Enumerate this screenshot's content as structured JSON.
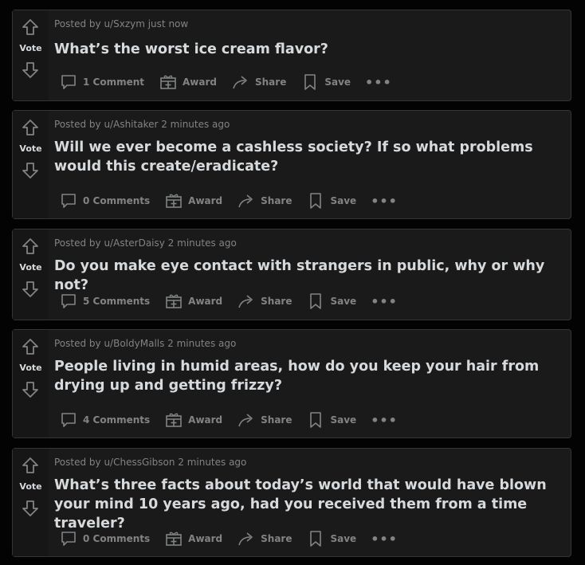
{
  "posts": [
    {
      "meta": "Posted by u/Sxzym just now",
      "title": "What’s the worst ice cream flavor?",
      "vote_label": "Vote",
      "comments": "1 Comment",
      "award": "Award",
      "share": "Share",
      "save": "Save",
      "more": "•••"
    },
    {
      "meta": "Posted by u/Ashitaker 2 minutes ago",
      "title": "Will we ever become a cashless society? If so what problems would this create/eradicate?",
      "vote_label": "Vote",
      "comments": "0 Comments",
      "award": "Award",
      "share": "Share",
      "save": "Save",
      "more": "•••"
    },
    {
      "meta": "Posted by u/AsterDaisy 2 minutes ago",
      "title": "Do you make eye contact with strangers in public, why or why not?",
      "vote_label": "Vote",
      "comments": "5 Comments",
      "award": "Award",
      "share": "Share",
      "save": "Save",
      "more": "•••"
    },
    {
      "meta": "Posted by u/BoldyMalls 2 minutes ago",
      "title": "People living in humid areas, how do you keep your hair from drying up and getting frizzy?",
      "vote_label": "Vote",
      "comments": "4 Comments",
      "award": "Award",
      "share": "Share",
      "save": "Save",
      "more": "•••"
    },
    {
      "meta": "Posted by u/ChessGibson 2 minutes ago",
      "title": "What’s three facts about today’s world that would have blown your mind 10 years ago, had you received them from a time traveler?",
      "vote_label": "Vote",
      "comments": "0 Comments",
      "award": "Award",
      "share": "Share",
      "save": "Save",
      "more": "•••"
    }
  ],
  "icons": {
    "upvote": "upvote-icon",
    "downvote": "downvote-icon",
    "comment": "comment-icon",
    "award": "award-icon",
    "share": "share-icon",
    "save": "bookmark-icon"
  }
}
